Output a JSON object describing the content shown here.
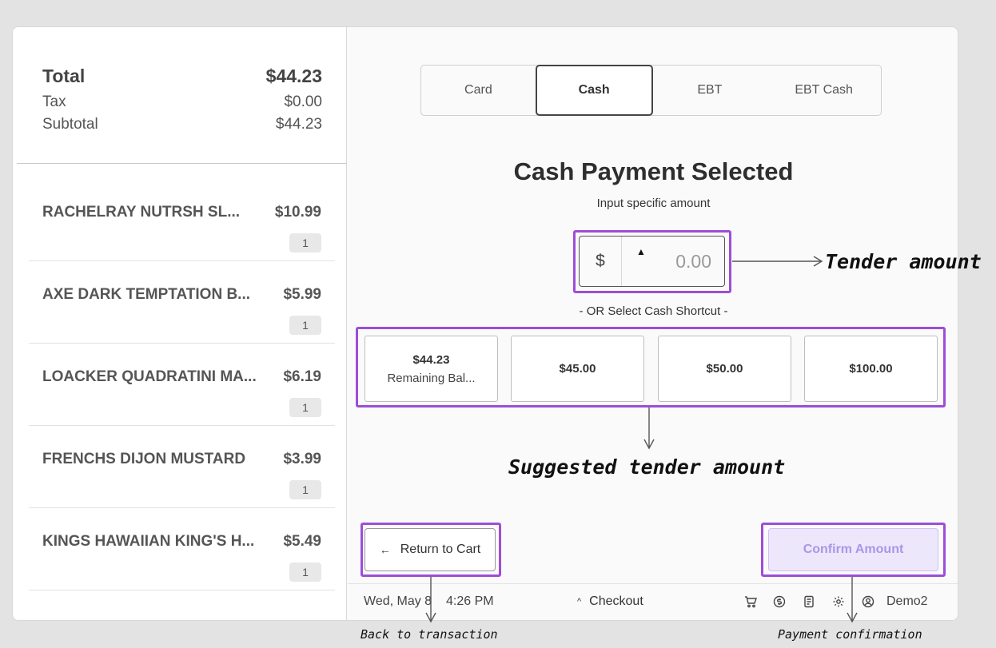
{
  "summary": {
    "total_label": "Total",
    "total_value": "$44.23",
    "tax_label": "Tax",
    "tax_value": "$0.00",
    "subtotal_label": "Subtotal",
    "subtotal_value": "$44.23"
  },
  "cart_items": [
    {
      "name": "RACHELRAY NUTRSH SL...",
      "price": "$10.99",
      "qty": "1"
    },
    {
      "name": "AXE DARK TEMPTATION B...",
      "price": "$5.99",
      "qty": "1"
    },
    {
      "name": "LOACKER QUADRATINI MA...",
      "price": "$6.19",
      "qty": "1"
    },
    {
      "name": "FRENCHS DIJON MUSTARD",
      "price": "$3.99",
      "qty": "1"
    },
    {
      "name": "KINGS HAWAIIAN KING'S H...",
      "price": "$5.49",
      "qty": "1"
    }
  ],
  "payment_tabs": [
    {
      "label": "Card"
    },
    {
      "label": "Cash"
    },
    {
      "label": "EBT"
    },
    {
      "label": "EBT Cash"
    }
  ],
  "active_tab": "Cash",
  "payment": {
    "title": "Cash Payment Selected",
    "input_label": "Input specific amount",
    "currency_symbol": "$",
    "amount_placeholder": "0.00",
    "amount_value": "",
    "or_label": "- OR Select Cash Shortcut -",
    "shortcuts": [
      {
        "amount": "$44.23",
        "sub": "Remaining Bal..."
      },
      {
        "amount": "$45.00"
      },
      {
        "amount": "$50.00"
      },
      {
        "amount": "$100.00"
      }
    ]
  },
  "actions": {
    "return_label": "Return to Cart",
    "confirm_label": "Confirm Amount"
  },
  "status_bar": {
    "date": "Wed, May 8",
    "time": "4:26 PM",
    "checkout_label": "Checkout",
    "icons": [
      "cart-icon",
      "dollar-circle-icon",
      "receipt-icon",
      "settings-gear-icon",
      "user-circle-icon"
    ],
    "user": "Demo2"
  },
  "annotations": {
    "tender_amount": "Tender amount",
    "suggested_tender": "Suggested tender amount",
    "back_to_transaction": "Back to transaction",
    "payment_confirmation": "Payment confirmation"
  },
  "colors": {
    "highlight": "#9d4ed8",
    "confirm_bg": "#ece7fb",
    "confirm_text": "#a996e6"
  }
}
